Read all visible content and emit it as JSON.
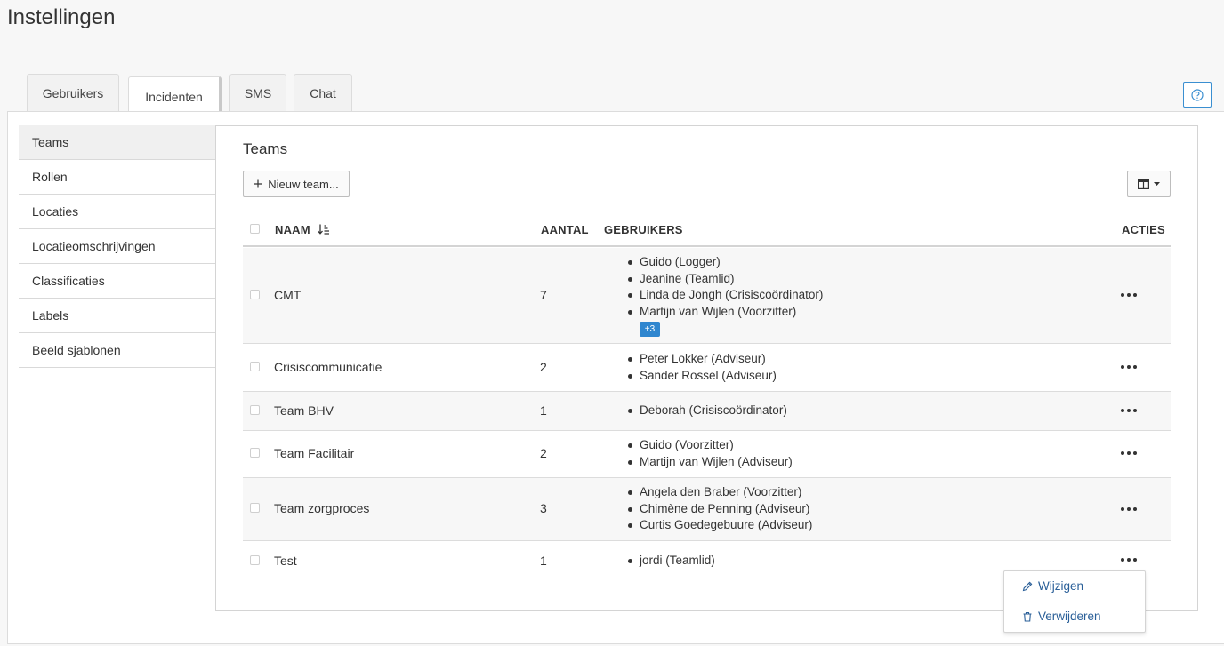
{
  "page": {
    "title": "Instellingen"
  },
  "tabs": [
    {
      "label": "Gebruikers"
    },
    {
      "label": "Incidenten",
      "active": true
    },
    {
      "label": "SMS"
    },
    {
      "label": "Chat"
    }
  ],
  "help_icon": "question-circle-icon",
  "sidebar": {
    "items": [
      {
        "label": "Teams",
        "active": true
      },
      {
        "label": "Rollen"
      },
      {
        "label": "Locaties"
      },
      {
        "label": "Locatieomschrijvingen"
      },
      {
        "label": "Classificaties"
      },
      {
        "label": "Labels"
      },
      {
        "label": "Beeld sjablonen"
      }
    ]
  },
  "main": {
    "title": "Teams",
    "new_button_label": "Nieuw team...",
    "table": {
      "headers": {
        "name": "NAAM",
        "count": "AANTAL",
        "users": "GEBRUIKERS",
        "actions": "ACTIES"
      },
      "rows": [
        {
          "name": "CMT",
          "count": "7",
          "users": [
            "Guido (Logger)",
            "Jeanine (Teamlid)",
            "Linda de Jongh (Crisiscoördinator)",
            "Martijn van Wijlen (Voorzitter)"
          ],
          "more": "+3"
        },
        {
          "name": "Crisiscommunicatie",
          "count": "2",
          "users": [
            "Peter Lokker (Adviseur)",
            "Sander Rossel (Adviseur)"
          ]
        },
        {
          "name": "Team BHV",
          "count": "1",
          "users": [
            "Deborah (Crisiscoördinator)"
          ]
        },
        {
          "name": "Team Facilitair",
          "count": "2",
          "users": [
            "Guido (Voorzitter)",
            "Martijn van Wijlen (Adviseur)"
          ]
        },
        {
          "name": "Team zorgproces",
          "count": "3",
          "users": [
            "Angela den Braber (Voorzitter)",
            "Chimène de Penning (Adviseur)",
            "Curtis Goedegebuure (Adviseur)"
          ]
        },
        {
          "name": "Test",
          "count": "1",
          "users": [
            "jordi (Teamlid)"
          ]
        }
      ]
    },
    "actions_menu": {
      "edit_label": "Wijzigen",
      "delete_label": "Verwijderen"
    }
  },
  "colors": {
    "accent": "#2f86cf",
    "link": "#2a5f98"
  }
}
